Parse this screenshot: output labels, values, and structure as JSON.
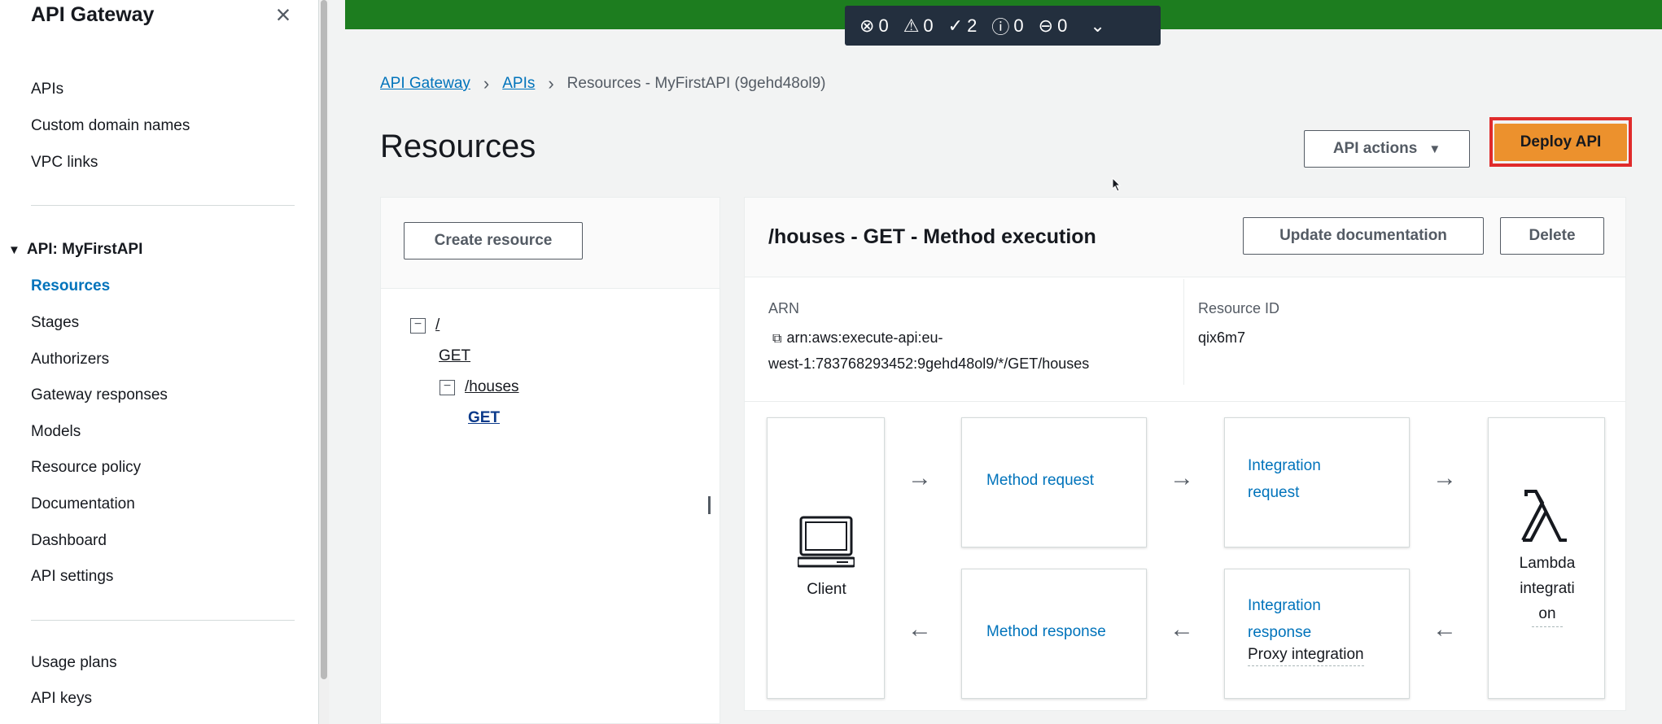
{
  "sidebar": {
    "title": "API Gateway",
    "top_items": [
      "APIs",
      "Custom domain names",
      "VPC links"
    ],
    "section_title": "API: MyFirstAPI",
    "api_items": [
      {
        "label": "Resources",
        "active": true
      },
      {
        "label": "Stages",
        "active": false
      },
      {
        "label": "Authorizers",
        "active": false
      },
      {
        "label": "Gateway responses",
        "active": false
      },
      {
        "label": "Models",
        "active": false
      },
      {
        "label": "Resource policy",
        "active": false
      },
      {
        "label": "Documentation",
        "active": false
      },
      {
        "label": "Dashboard",
        "active": false
      },
      {
        "label": "API settings",
        "active": false
      }
    ],
    "bottom_items": [
      "Usage plans",
      "API keys"
    ]
  },
  "status_bar": {
    "error_count": "0",
    "warning_count": "0",
    "success_count": "2",
    "info_count": "0",
    "pending_count": "0"
  },
  "breadcrumb": {
    "items": [
      "API Gateway",
      "APIs"
    ],
    "current": "Resources - MyFirstAPI (9gehd48ol9)"
  },
  "page": {
    "title": "Resources",
    "api_actions_label": "API actions",
    "deploy_label": "Deploy API"
  },
  "left_panel": {
    "create_label": "Create resource",
    "tree": {
      "root": "/",
      "root_method": "GET",
      "child": "/houses",
      "child_method": "GET"
    }
  },
  "method": {
    "title": "/houses - GET - Method execution",
    "update_doc_label": "Update documentation",
    "delete_label": "Delete",
    "arn_label": "ARN",
    "arn_line1": "arn:aws:execute-api:eu-",
    "arn_line2": "west-1:783768293452:9gehd48ol9/*/GET/houses",
    "resource_id_label": "Resource ID",
    "resource_id": "qix6m7"
  },
  "flow": {
    "client_label": "Client",
    "method_request": "Method request",
    "integration_request_1": "Integration",
    "integration_request_2": "request",
    "method_response": "Method response",
    "integration_response_1": "Integration",
    "integration_response_2": "response",
    "proxy_label": "Proxy integration",
    "lambda_1": "Lambda",
    "lambda_2": "integrati",
    "lambda_3": "on"
  },
  "colors": {
    "banner": "#1d7d1f",
    "link": "#0073bb",
    "primary": "#ec912d",
    "highlight": "#e02b2b"
  }
}
